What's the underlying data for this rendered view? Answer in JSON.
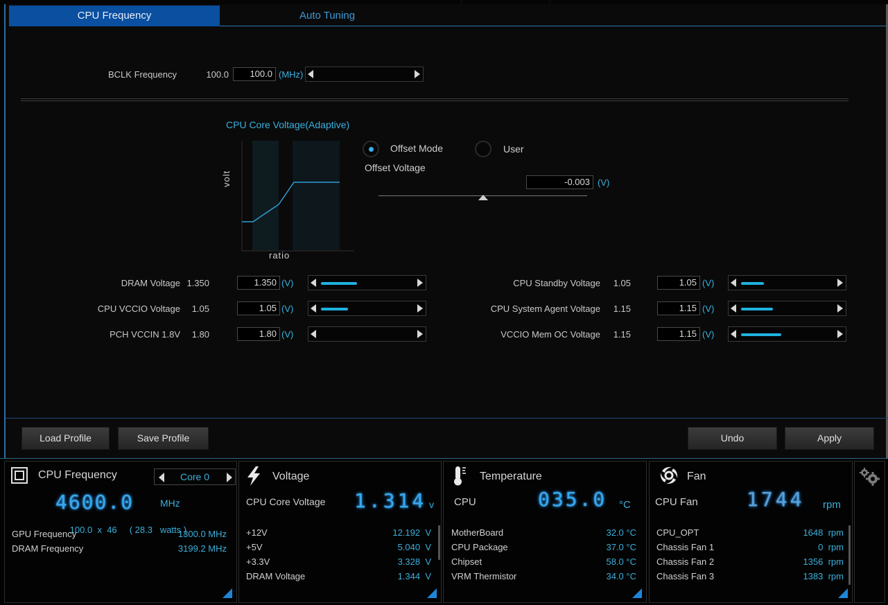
{
  "tabs": [
    {
      "label": "CPU Frequency",
      "active": true
    },
    {
      "label": "Auto Tuning",
      "active": false
    }
  ],
  "bclk": {
    "label": "BCLK Frequency",
    "current": "100.0",
    "value": "100.0",
    "unit": "(MHz)"
  },
  "core_voltage": {
    "title": "CPU Core Voltage(Adaptive)",
    "chart": {
      "xlabel": "ratio",
      "ylabel": "volt"
    },
    "modes": [
      {
        "label": "Offset Mode",
        "selected": true
      },
      {
        "label": "User",
        "selected": false
      }
    ],
    "offset_label": "Offset Voltage",
    "offset_value": "-0.003",
    "offset_unit": "(V)",
    "offset_slider_position": 0.5
  },
  "voltages_left": [
    {
      "label": "DRAM Voltage",
      "current": "1.350",
      "value": "1.350",
      "unit": "(V)",
      "level": 0.36
    },
    {
      "label": "CPU VCCIO Voltage",
      "current": "1.05",
      "value": "1.05",
      "unit": "(V)",
      "level": 0.27
    },
    {
      "label": "PCH VCCIN 1.8V",
      "current": "1.80",
      "value": "1.80",
      "unit": "(V)",
      "level": 0
    }
  ],
  "voltages_right": [
    {
      "label": "CPU Standby Voltage",
      "current": "1.05",
      "value": "1.05",
      "unit": "(V)",
      "level": 0.23
    },
    {
      "label": "CPU System Agent Voltage",
      "current": "1.15",
      "value": "1.15",
      "unit": "(V)",
      "level": 0.32
    },
    {
      "label": "VCCIO Mem OC Voltage",
      "current": "1.15",
      "value": "1.15",
      "unit": "(V)",
      "level": 0.4
    }
  ],
  "buttons": {
    "load": "Load Profile",
    "save": "Save Profile",
    "undo": "Undo",
    "apply": "Apply"
  },
  "monitor": {
    "cpu_freq": {
      "title": "CPU Frequency",
      "core": "Core 0",
      "big_value": "4600.0",
      "big_unit": "MHz",
      "bclk": "100.0",
      "x": "x",
      "ratio": "46",
      "watts_open": "( 28.3",
      "watts_unit": "watts )",
      "rows": [
        {
          "label": "GPU Frequency",
          "value": "1300.0  MHz"
        },
        {
          "label": "DRAM Frequency",
          "value": "3199.2  MHz"
        }
      ]
    },
    "voltage": {
      "title": "Voltage",
      "main_label": "CPU Core Voltage",
      "big_value": "1.314",
      "big_unit": "v",
      "rows": [
        {
          "label": "+12V",
          "value": "12.192  V"
        },
        {
          "label": "+5V",
          "value": "5.040  V"
        },
        {
          "label": "+3.3V",
          "value": "3.328  V"
        },
        {
          "label": "DRAM Voltage",
          "value": "1.344  V"
        }
      ]
    },
    "temperature": {
      "title": "Temperature",
      "main_label": "CPU",
      "big_value": "035.0",
      "big_unit": "°C",
      "rows": [
        {
          "label": "MotherBoard",
          "value": "32.0 °C"
        },
        {
          "label": "CPU Package",
          "value": "37.0 °C"
        },
        {
          "label": "Chipset",
          "value": "58.0 °C"
        },
        {
          "label": "VRM Thermistor",
          "value": "34.0 °C"
        }
      ]
    },
    "fan": {
      "title": "Fan",
      "main_label": "CPU Fan",
      "big_value": "1744",
      "big_unit": "rpm",
      "rows": [
        {
          "label": "CPU_OPT",
          "value": "1648  rpm"
        },
        {
          "label": "Chassis Fan 1",
          "value": "0  rpm"
        },
        {
          "label": "Chassis Fan 2",
          "value": "1356  rpm"
        },
        {
          "label": "Chassis Fan 3",
          "value": "1383  rpm"
        }
      ]
    }
  },
  "icons": {
    "cpu": "cpu-chip-icon",
    "voltage": "lightning-bolt-icon",
    "temperature": "thermometer-icon",
    "fan": "fan-icon",
    "settings": "gear-icon"
  },
  "colors": {
    "accent": "#0a4fa0",
    "value_blue": "#3ab0dc",
    "slider_fill": "#1fb2df",
    "glow": "#35a8f0"
  }
}
